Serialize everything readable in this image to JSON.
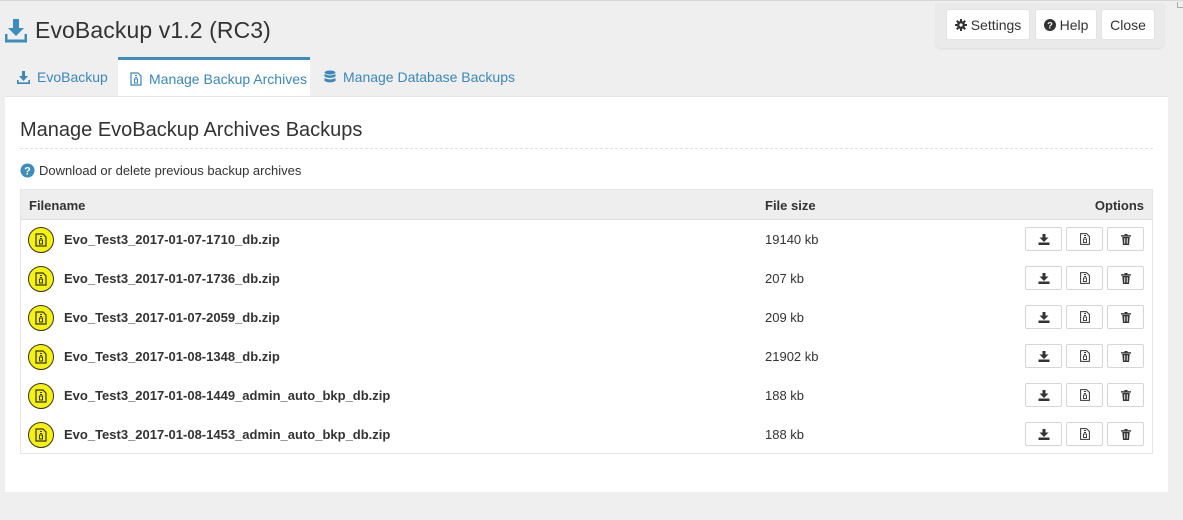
{
  "app": {
    "title": "EvoBackup v1.2 (RC3)"
  },
  "top_buttons": {
    "settings_label": "Settings",
    "help_label": "Help",
    "close_label": "Close"
  },
  "tabs": [
    {
      "label": "EvoBackup",
      "icon": "download-icon",
      "active": false
    },
    {
      "label": "Manage Backup Archives",
      "icon": "archive-file-icon",
      "active": true
    },
    {
      "label": "Manage Database Backups",
      "icon": "database-icon",
      "active": false
    }
  ],
  "section": {
    "title": "Manage EvoBackup Archives Backups",
    "info": "Download or delete previous backup archives"
  },
  "table": {
    "columns": [
      "Filename",
      "File size",
      "Options"
    ],
    "rows": [
      {
        "filename": "Evo_Test3_2017-01-07-1710_db.zip",
        "size": "19140 kb"
      },
      {
        "filename": "Evo_Test3_2017-01-07-1736_db.zip",
        "size": "207 kb"
      },
      {
        "filename": "Evo_Test3_2017-01-07-2059_db.zip",
        "size": "209 kb"
      },
      {
        "filename": "Evo_Test3_2017-01-08-1348_db.zip",
        "size": "21902 kb"
      },
      {
        "filename": "Evo_Test3_2017-01-08-1449_admin_auto_bkp_db.zip",
        "size": "188 kb"
      },
      {
        "filename": "Evo_Test3_2017-01-08-1453_admin_auto_bkp_db.zip",
        "size": "188 kb"
      }
    ],
    "row_option_icons": [
      "download-icon",
      "archive-file-icon",
      "trash-icon"
    ]
  },
  "colors": {
    "accent": "#3c8dbc",
    "link": "#3a87b8",
    "file_badge": "#f7f20a"
  }
}
